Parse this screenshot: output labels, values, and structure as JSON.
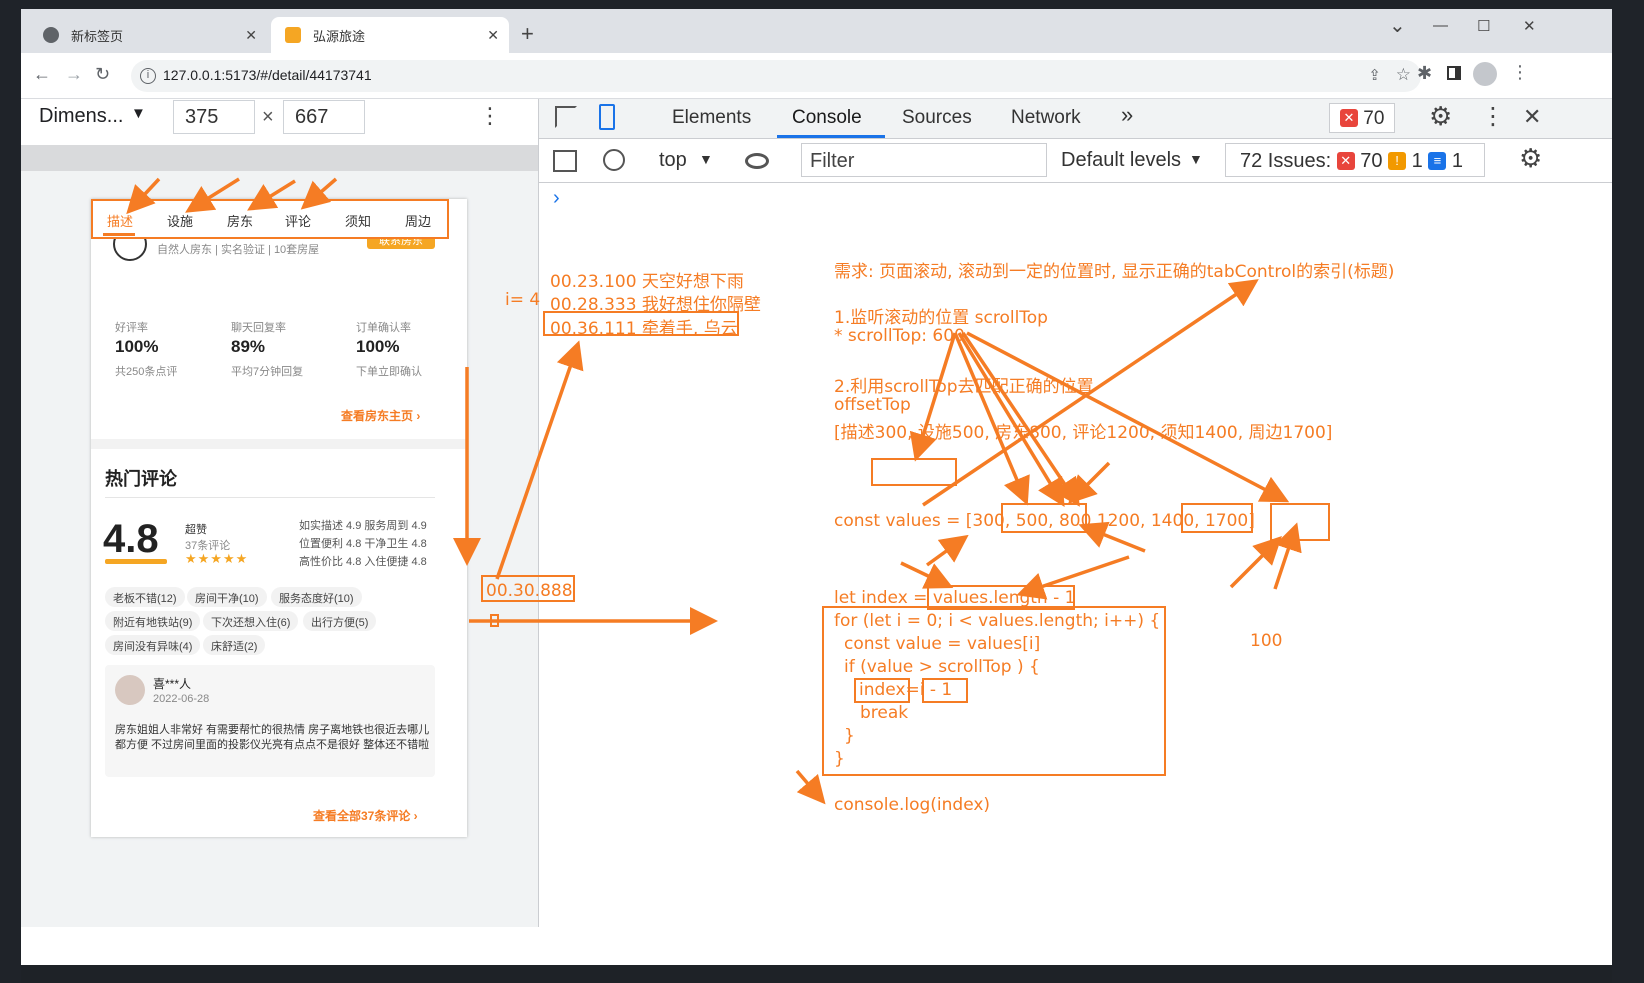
{
  "browser": {
    "tabs": [
      {
        "title": "新标签页",
        "close": "✕"
      },
      {
        "title": "弘源旅途",
        "close": "✕"
      }
    ],
    "new_tab": "+",
    "url": "127.0.0.1:5173/#/detail/44173741",
    "window_controls": {
      "collapse": "⌄",
      "minimize": "—",
      "maximize": "☐",
      "close": "✕"
    },
    "nav": {
      "back": "←",
      "forward": "→",
      "reload": "↻"
    }
  },
  "device_toolbar": {
    "dimensions_label": "Dimens...",
    "dropdown_arrow": "▼",
    "width": "375",
    "times": "×",
    "height": "667",
    "more": "⋮"
  },
  "phone": {
    "tabs": [
      "描述",
      "设施",
      "房东",
      "评论",
      "须知",
      "周边"
    ],
    "active_tab": 0,
    "host_line": "自然人房东 | 实名验证 | 10套房屋",
    "host_button": "联系房东",
    "stats": [
      {
        "label": "好评率",
        "value": "100%",
        "sub": "共250条点评"
      },
      {
        "label": "聊天回复率",
        "value": "89%",
        "sub": "平均7分钟回复"
      },
      {
        "label": "订单确认率",
        "value": "100%",
        "sub": "下单立即确认"
      }
    ],
    "host_link": "查看房东主页 ›",
    "comments_title": "热门评论",
    "score": "4.8",
    "score_word": "超赞",
    "score_count": "37条评论",
    "stars": "★★★★★",
    "score_details": [
      "如实描述 4.9 服务周到 4.9",
      "位置便利 4.8 干净卫生 4.8",
      "高性价比 4.8 入住便捷 4.8"
    ],
    "tags": [
      "老板不错(12)",
      "房间干净(10)",
      "服务态度好(10)",
      "附近有地铁站(9)",
      "下次还想入住(6)",
      "出行方便(5)",
      "房间没有异味(4)",
      "床舒适(2)"
    ],
    "review": {
      "user": "喜***人",
      "date": "2022-06-28",
      "text": "房东姐姐人非常好 有需要帮忙的很热情 房子离地铁也很近去哪儿都方便 不过房间里面的投影仪光亮有点点不是很好 整体还不错啦"
    },
    "all_link": "查看全部37条评论 ›"
  },
  "devtools": {
    "tabs": [
      "Elements",
      "Console",
      "Sources",
      "Network"
    ],
    "more_tabs": "»",
    "active_tab": "Console",
    "error_count": "70",
    "context": "top",
    "filter_placeholder": "Filter",
    "levels": "Default levels",
    "issues_label": "72 Issues:",
    "issues_errors": "70",
    "issues_warnings": "1",
    "issues_info": "1",
    "prompt": "›",
    "close": "✕"
  },
  "annotations": {
    "lyric1": "00.23.100 天空好想下雨",
    "lyric_i": "i= 4",
    "lyric2": "00.28.333 我好想住你隔壁",
    "lyric3": "00.36.111 牵着手, 乌云",
    "current_time": "00.30.888",
    "req": "需求: 页面滚动, 滚动到一定的位置时, 显示正确的tabControl的索引(标题)",
    "step1": "1.监听滚动的位置 scrollTop",
    "step1b": "* scrollTop: 600",
    "step2": "2.利用scrollTop去匹配正确的位置",
    "step2b": "offsetTop",
    "step2c": "[描述300, 设施500, 房东800, 评论1200, 须知1400, 周边1700]",
    "values_prefix": "const values = [300,",
    "values_box1": "500, 800",
    "values_mid": "1200, 1400,",
    "values_box2": "1700]",
    "index_prefix": "let index =",
    "index_box": "values.length - 1",
    "for_line": "for (let i = 0; i < values.length; i++) {",
    "const_line": "const value = values[i]",
    "if_line": "if (value > scrollTop ) {",
    "index_var": "index",
    "assign": "=",
    "i_minus": "i - 1",
    "break": "break",
    "close1": "}",
    "close2": "}",
    "console_log": "console.log(index)",
    "hundred": "100"
  },
  "colors": {
    "accent": "#f57c24",
    "devtools_blue": "#1a73e8",
    "error_red": "#e8453c"
  }
}
